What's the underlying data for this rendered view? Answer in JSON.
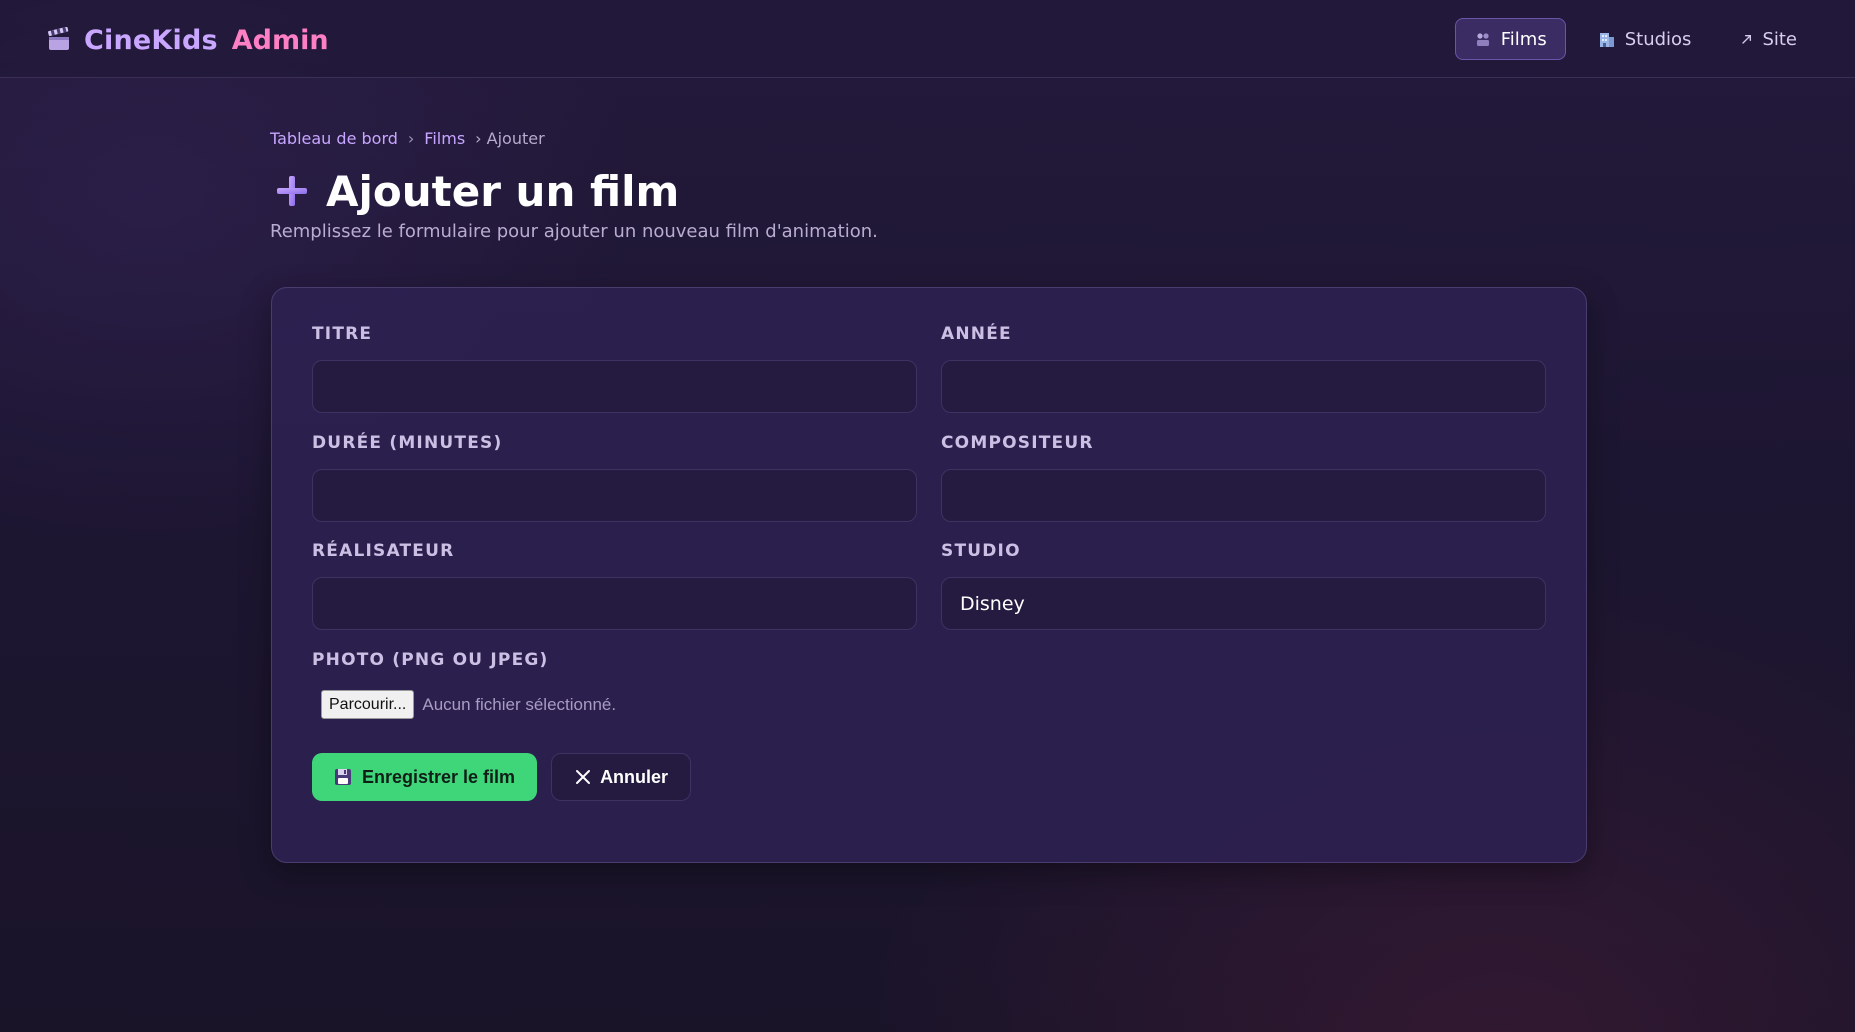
{
  "brand": {
    "name": "CineKids",
    "suffix": "Admin"
  },
  "nav": {
    "items": [
      {
        "label": "Films",
        "icon": "film-people-icon",
        "active": true
      },
      {
        "label": "Studios",
        "icon": "building-icon",
        "active": false
      },
      {
        "label": "Site",
        "icon": "external-arrow-icon",
        "active": false
      }
    ]
  },
  "breadcrumb": {
    "dashboard": "Tableau de bord",
    "films": "Films",
    "sep": "›",
    "current": "› Ajouter"
  },
  "page": {
    "title": "Ajouter un film",
    "subtitle": "Remplissez le formulaire pour ajouter un nouveau film d'animation."
  },
  "form": {
    "titre": {
      "label": "TITRE",
      "value": ""
    },
    "annee": {
      "label": "ANNÉE",
      "value": ""
    },
    "duree": {
      "label": "DURÉE (MINUTES)",
      "value": ""
    },
    "compositeur": {
      "label": "COMPOSITEUR",
      "value": ""
    },
    "realisateur": {
      "label": "RÉALISATEUR",
      "value": ""
    },
    "studio": {
      "label": "STUDIO",
      "value": "Disney"
    },
    "photo": {
      "label": "PHOTO (PNG OU JPEG)",
      "button": "Parcourir...",
      "status": "Aucun fichier sélectionné."
    }
  },
  "actions": {
    "save": "Enregistrer le film",
    "cancel": "Annuler"
  },
  "colors": {
    "accent_purple": "#c9a6ff",
    "accent_pink": "#ff7fc4",
    "save_green": "#3fd67a",
    "card_bg": "#2d2150"
  }
}
